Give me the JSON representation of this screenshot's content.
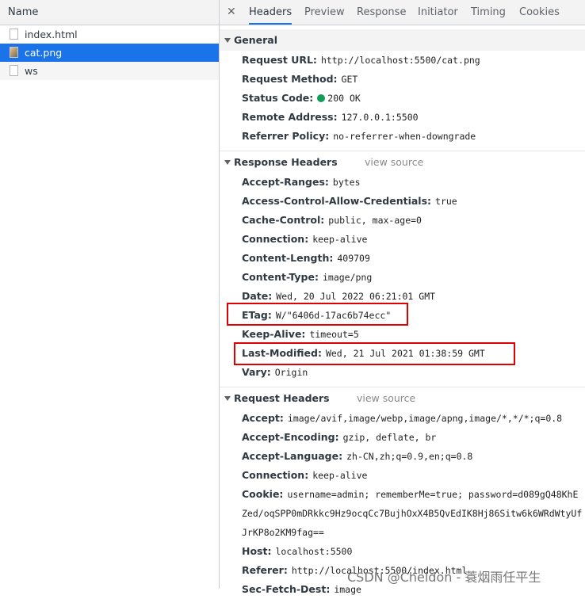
{
  "left_panel": {
    "header": "Name",
    "files": [
      {
        "name": "index.html",
        "icon": "document-icon"
      },
      {
        "name": "cat.png",
        "icon": "image-file-icon"
      },
      {
        "name": "ws",
        "icon": "document-icon"
      }
    ]
  },
  "tabs": [
    "Headers",
    "Preview",
    "Response",
    "Initiator",
    "Timing",
    "Cookies"
  ],
  "general": {
    "title": "General",
    "rows": [
      {
        "name": "Request URL:",
        "value": "http://localhost:5500/cat.png"
      },
      {
        "name": "Request Method:",
        "value": "GET"
      },
      {
        "name": "Status Code:",
        "value": "200  OK"
      },
      {
        "name": "Remote Address:",
        "value": "127.0.0.1:5500"
      },
      {
        "name": "Referrer Policy:",
        "value": "no-referrer-when-downgrade"
      }
    ]
  },
  "response_headers": {
    "title": "Response Headers",
    "view_source": "view source",
    "rows": [
      {
        "name": "Accept-Ranges:",
        "value": "bytes"
      },
      {
        "name": "Access-Control-Allow-Credentials:",
        "value": "true"
      },
      {
        "name": "Cache-Control:",
        "value": "public, max-age=0"
      },
      {
        "name": "Connection:",
        "value": "keep-alive"
      },
      {
        "name": "Content-Length:",
        "value": "409709"
      },
      {
        "name": "Content-Type:",
        "value": "image/png"
      },
      {
        "name": "Date:",
        "value": "Wed, 20 Jul 2022 06:21:01 GMT"
      },
      {
        "name": "ETag:",
        "value": "W/\"6406d-17ac6b74ecc\""
      },
      {
        "name": "Keep-Alive:",
        "value": "timeout=5"
      },
      {
        "name": "Last-Modified:",
        "value": "Wed, 21 Jul 2021 01:38:59 GMT"
      },
      {
        "name": "Vary:",
        "value": "Origin"
      }
    ]
  },
  "request_headers": {
    "title": "Request Headers",
    "view_source": "view source",
    "rows": [
      {
        "name": "Accept:",
        "value": "image/avif,image/webp,image/apng,image/*,*/*;q=0.8"
      },
      {
        "name": "Accept-Encoding:",
        "value": "gzip, deflate, br"
      },
      {
        "name": "Accept-Language:",
        "value": "zh-CN,zh;q=0.9,en;q=0.8"
      },
      {
        "name": "Connection:",
        "value": "keep-alive"
      },
      {
        "name": "Cookie:",
        "value": "username=admin; rememberMe=true; password=d089gQ48KhEZed/oqSPP0mDRkkc9Hz9ocqCc7BujhOxX4B5QvEdIK8Hj86Sitw6k6WRdWtyUfJrKP8o2KM9fag=="
      },
      {
        "name": "Host:",
        "value": "localhost:5500"
      },
      {
        "name": "Referer:",
        "value": "http://localhost:5500/index.html"
      },
      {
        "name": "Sec-Fetch-Dest:",
        "value": "image"
      }
    ]
  },
  "watermark": "CSDN @Cheldon - 蓑烟雨任平生",
  "colors": {
    "accent": "#1a73e8",
    "status_ok": "#0f9d58",
    "highlight_box": "#e00000"
  }
}
